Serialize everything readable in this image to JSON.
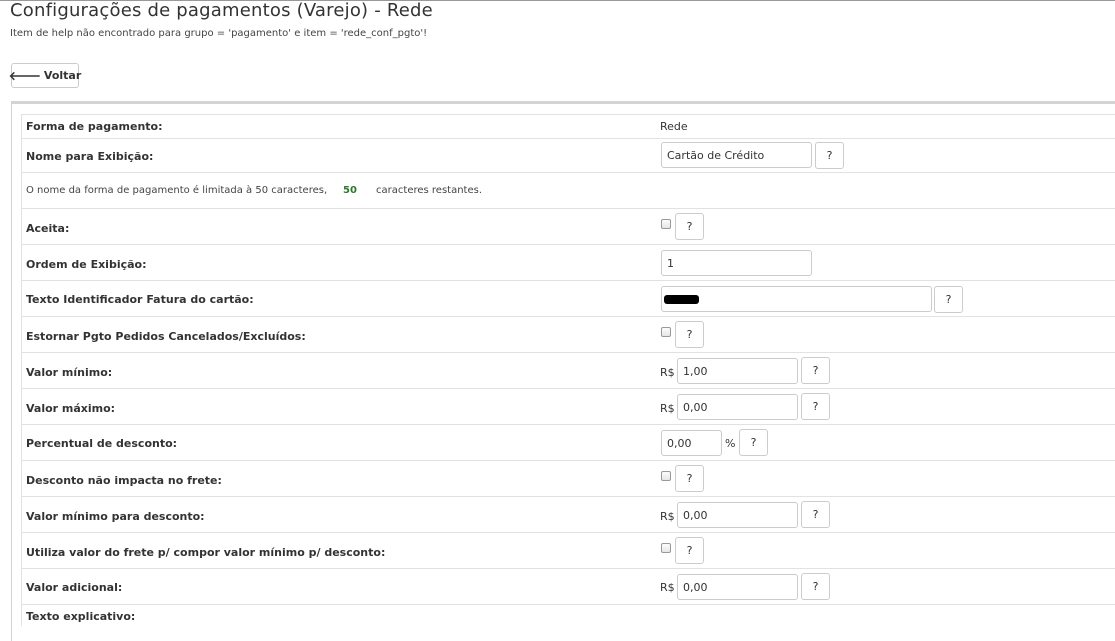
{
  "page": {
    "title": "Configurações de pagamentos (Varejo) - Rede",
    "help_message": "Item de help não encontrado para grupo = 'pagamento' e item = 'rede_conf_pgto'!",
    "back_label": "Voltar"
  },
  "form": {
    "forma_pagamento": {
      "label": "Forma de pagamento:",
      "value": "Rede"
    },
    "nome_exibicao": {
      "label": "Nome para Exibição:",
      "value": "Cartão de Crédito"
    },
    "limit_note": {
      "prefix": "O nome da forma de pagamento é limitada à 50 caracteres,",
      "remaining": "50",
      "suffix": "caracteres restantes."
    },
    "aceita": {
      "label": "Aceita:",
      "checked": false
    },
    "ordem_exibicao": {
      "label": "Ordem de Exibição:",
      "value": "1"
    },
    "texto_fatura": {
      "label": "Texto Identificador Fatura do cartão:",
      "value": ""
    },
    "estornar": {
      "label": "Estornar Pgto Pedidos Cancelados/Excluídos:",
      "checked": false
    },
    "valor_minimo": {
      "label": "Valor mínimo:",
      "currency": "R$",
      "value": "1,00"
    },
    "valor_maximo": {
      "label": "Valor máximo:",
      "currency": "R$",
      "value": "0,00"
    },
    "percentual_desconto": {
      "label": "Percentual de desconto:",
      "value": "0,00",
      "unit": "%"
    },
    "desconto_frete": {
      "label": "Desconto não impacta no frete:",
      "checked": false
    },
    "valor_minimo_desconto": {
      "label": "Valor mínimo para desconto:",
      "currency": "R$",
      "value": "0,00"
    },
    "utiliza_frete": {
      "label": "Utiliza valor do frete p/ compor valor mínimo p/ desconto:",
      "checked": false
    },
    "valor_adicional": {
      "label": "Valor adicional:",
      "currency": "R$",
      "value": "0,00"
    },
    "texto_explicativo": {
      "label": "Texto explicativo:"
    }
  },
  "help_button_label": "?"
}
